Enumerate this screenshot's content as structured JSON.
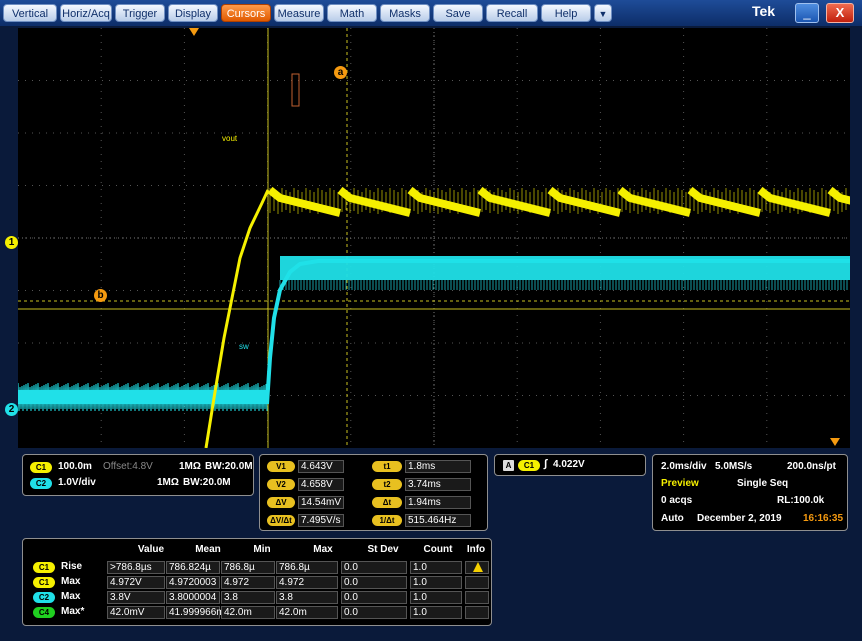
{
  "menu": {
    "items": [
      "Vertical",
      "Horiz/Acq",
      "Trigger",
      "Display",
      "Cursors",
      "Measure",
      "Math",
      "Masks",
      "Save",
      "Recall",
      "Help"
    ],
    "active": "Cursors",
    "dropdown_glyph": "▼",
    "brand": "Tek",
    "minimize_glyph": "_",
    "close_glyph": "X"
  },
  "screen": {
    "label_vout": "vout",
    "label_sw": "sw",
    "cursor_a": "a",
    "cursor_b": "b",
    "ch1_marker": "1",
    "ch2_marker": "2",
    "colors": {
      "ch1": "#f5f000",
      "ch2": "#20e0e8",
      "cursor": "#c8c020",
      "trigger": "#f59a10",
      "grid": "#555555"
    }
  },
  "channels": {
    "c1_chip": "C1",
    "c1_scale": "100.0m",
    "c1_offset_label": "Offset:4.8V",
    "c1_impedance": "1MΩ",
    "c1_bw": "BW:20.0M",
    "c2_chip": "C2",
    "c2_scale": "1.0V/div",
    "c2_impedance": "1MΩ",
    "c2_bw": "BW:20.0M"
  },
  "cursors": {
    "v1_label": "V1",
    "v1_value": "4.643V",
    "v2_label": "V2",
    "v2_value": "4.658V",
    "dv_label": "ΔV",
    "dv_value": "14.54mV",
    "dvdt_label": "ΔV/Δt",
    "dvdt_value": "7.495V/s",
    "t1_label": "t1",
    "t1_value": "1.8ms",
    "t2_label": "t2",
    "t2_value": "3.74ms",
    "dt_label": "Δt",
    "dt_value": "1.94ms",
    "invdt_label": "1/Δt",
    "invdt_value": "515.464Hz"
  },
  "trigger": {
    "a_chip": "A",
    "c1_chip": "C1",
    "slope_glyph": "∫",
    "level": "4.022V"
  },
  "acquisition": {
    "timebase": "2.0ms/div",
    "sample_rate": "5.0MS/s",
    "resolution": "200.0ns/pt",
    "mode": "Preview",
    "seq": "Single Seq",
    "acqs": "0 acqs",
    "record_length": "RL:100.0k",
    "trigger_mode": "Auto",
    "date": "December 2, 2019",
    "time": "16:16:35"
  },
  "measurements": {
    "headers": [
      "Value",
      "Mean",
      "Min",
      "Max",
      "St Dev",
      "Count",
      "Info"
    ],
    "rows": [
      {
        "chip": "C1",
        "chip_color": "#f5f000",
        "name": "Rise",
        "value": ">786.8µs",
        "mean": "786.824µ",
        "min": "786.8µ",
        "max": "786.8µ",
        "stdev": "0.0",
        "count": "1.0",
        "info": "warning-icon"
      },
      {
        "chip": "C1",
        "chip_color": "#f5f000",
        "name": "Max",
        "value": "4.972V",
        "mean": "4.9720003",
        "min": "4.972",
        "max": "4.972",
        "stdev": "0.0",
        "count": "1.0",
        "info": ""
      },
      {
        "chip": "C2",
        "chip_color": "#20e0e8",
        "name": "Max",
        "value": "3.8V",
        "mean": "3.8000004",
        "min": "3.8",
        "max": "3.8",
        "stdev": "0.0",
        "count": "1.0",
        "info": ""
      },
      {
        "chip": "C4",
        "chip_color": "#20d020",
        "name": "Max*",
        "value": "42.0mV",
        "mean": "41.999966m",
        "min": "42.0m",
        "max": "42.0m",
        "stdev": "0.0",
        "count": "1.0",
        "info": ""
      }
    ]
  }
}
